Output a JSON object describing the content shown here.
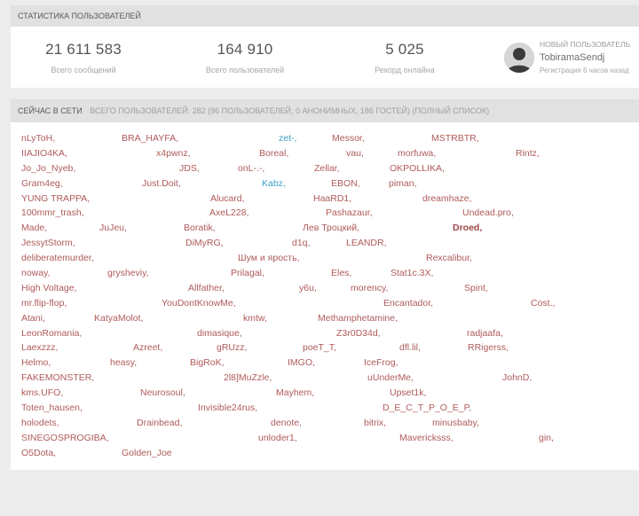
{
  "stats": {
    "title": "СТАТИСТИКА ПОЛЬЗОВАТЕЛЕЙ",
    "items": [
      {
        "value": "21 611 583",
        "label": "Всего сообщений"
      },
      {
        "value": "164 910",
        "label": "Всего пользователей"
      },
      {
        "value": "5 025",
        "label": "Рекорд онлайна"
      }
    ],
    "newest": {
      "title": "НОВЫЙ ПОЛЬЗОВАТЕЛЬ",
      "name": "TobiramaSendj",
      "registered": "Регистрация 6 часов назад"
    }
  },
  "online": {
    "title": "СЕЙЧАС В СЕТИ",
    "summary": "ВСЕГО ПОЛЬЗОВАТЕЛЕЙ: 282 (96 ПОЛЬЗОВАТЕЛЕЙ, 0 АНОНИМНЫХ, 186 ГОСТЕЙ) (ПОЛНЫЙ СПИСОК)",
    "rows": [
      [
        "nLyToH,",
        "BRA_HAYFA,",
        "zet-,",
        "Messor,",
        "MSTRBTR,"
      ],
      [
        "IIAJIO4KA,",
        "x4pwnz,",
        "Boreal,",
        "vau,",
        "morfuwa,",
        "Rintz,"
      ],
      [
        "Jo_Jo_Nyeb,",
        "JDS,",
        "onL-.-,",
        "Zellar,",
        "OKPOLLIKA,"
      ],
      [
        "Gram4eg,",
        "Just.Doit,",
        "Kabz,",
        "EBON,",
        "piman,"
      ],
      [
        "YUNG TRAPPA,",
        "Alucard,",
        "HaaRD1,",
        "dreamhaze,"
      ],
      [
        "100mmr_trash,",
        "AxeL228,",
        "Pashazaur,",
        "Undead.pro,"
      ],
      [
        "Made,",
        "JuJeu,",
        "Boratik,",
        "Лев Троцкий,",
        "Droed,"
      ],
      [
        "JessytStorm,",
        "DiMyRG,",
        "d1q,",
        "LEANDR,"
      ],
      [
        "deliberatemurder,",
        "Шум и ярость,",
        "Rexcalibur,"
      ],
      [
        "noway,",
        "grysheviy,",
        "Prilagal,",
        "Eles,",
        "Stat1c.3X,"
      ],
      [
        "High Voltage,",
        "Allfather,",
        "y6u,",
        "morency,",
        "Spint,"
      ],
      [
        "mr.flip-flop,",
        "YouDontKnowMe,",
        "Encantador,",
        "Cost.,"
      ],
      [
        "Atani,",
        "KatyaMolot,",
        "kmtw,",
        "Methamphetamine,"
      ],
      [
        "LeonRomania,",
        "dimasique,",
        "Z3r0D34d,",
        "radjaafa,"
      ],
      [
        "Laexzzz,",
        "Azreet,",
        "gRUzz,",
        "poeT_T,",
        "dfl.lil,",
        "RRigerss,"
      ],
      [
        "Helmo,",
        "heasy,",
        "BigRoK,",
        "IMGO,",
        "IceFrog,"
      ],
      [
        "FAKEMONSTER,",
        "2l8]MuZzle,",
        "uUnderMe,",
        "JohnD,"
      ],
      [
        "kms.UFO,",
        "Neurosoul,",
        "Mayhem,",
        "Upset1k,"
      ],
      [
        "Toten_hausen,",
        "Invisible24rus,",
        "D_E_C_T_P_O_E_P,"
      ],
      [
        "holodets,",
        "Drainbead,",
        "denote,",
        "bitrix,",
        "minusbaby,"
      ],
      [
        "SINEGOSPROGIBA,",
        "unloder1,",
        "Mavericksss,",
        "gin,"
      ],
      [
        "O5Dota,",
        "Golden_Joe"
      ]
    ]
  },
  "colors": {
    "page_bg": "#ececec",
    "header_bg": "#e1e1e1",
    "user_link": "#b05a5a",
    "moderator": "#3ca0c8"
  }
}
